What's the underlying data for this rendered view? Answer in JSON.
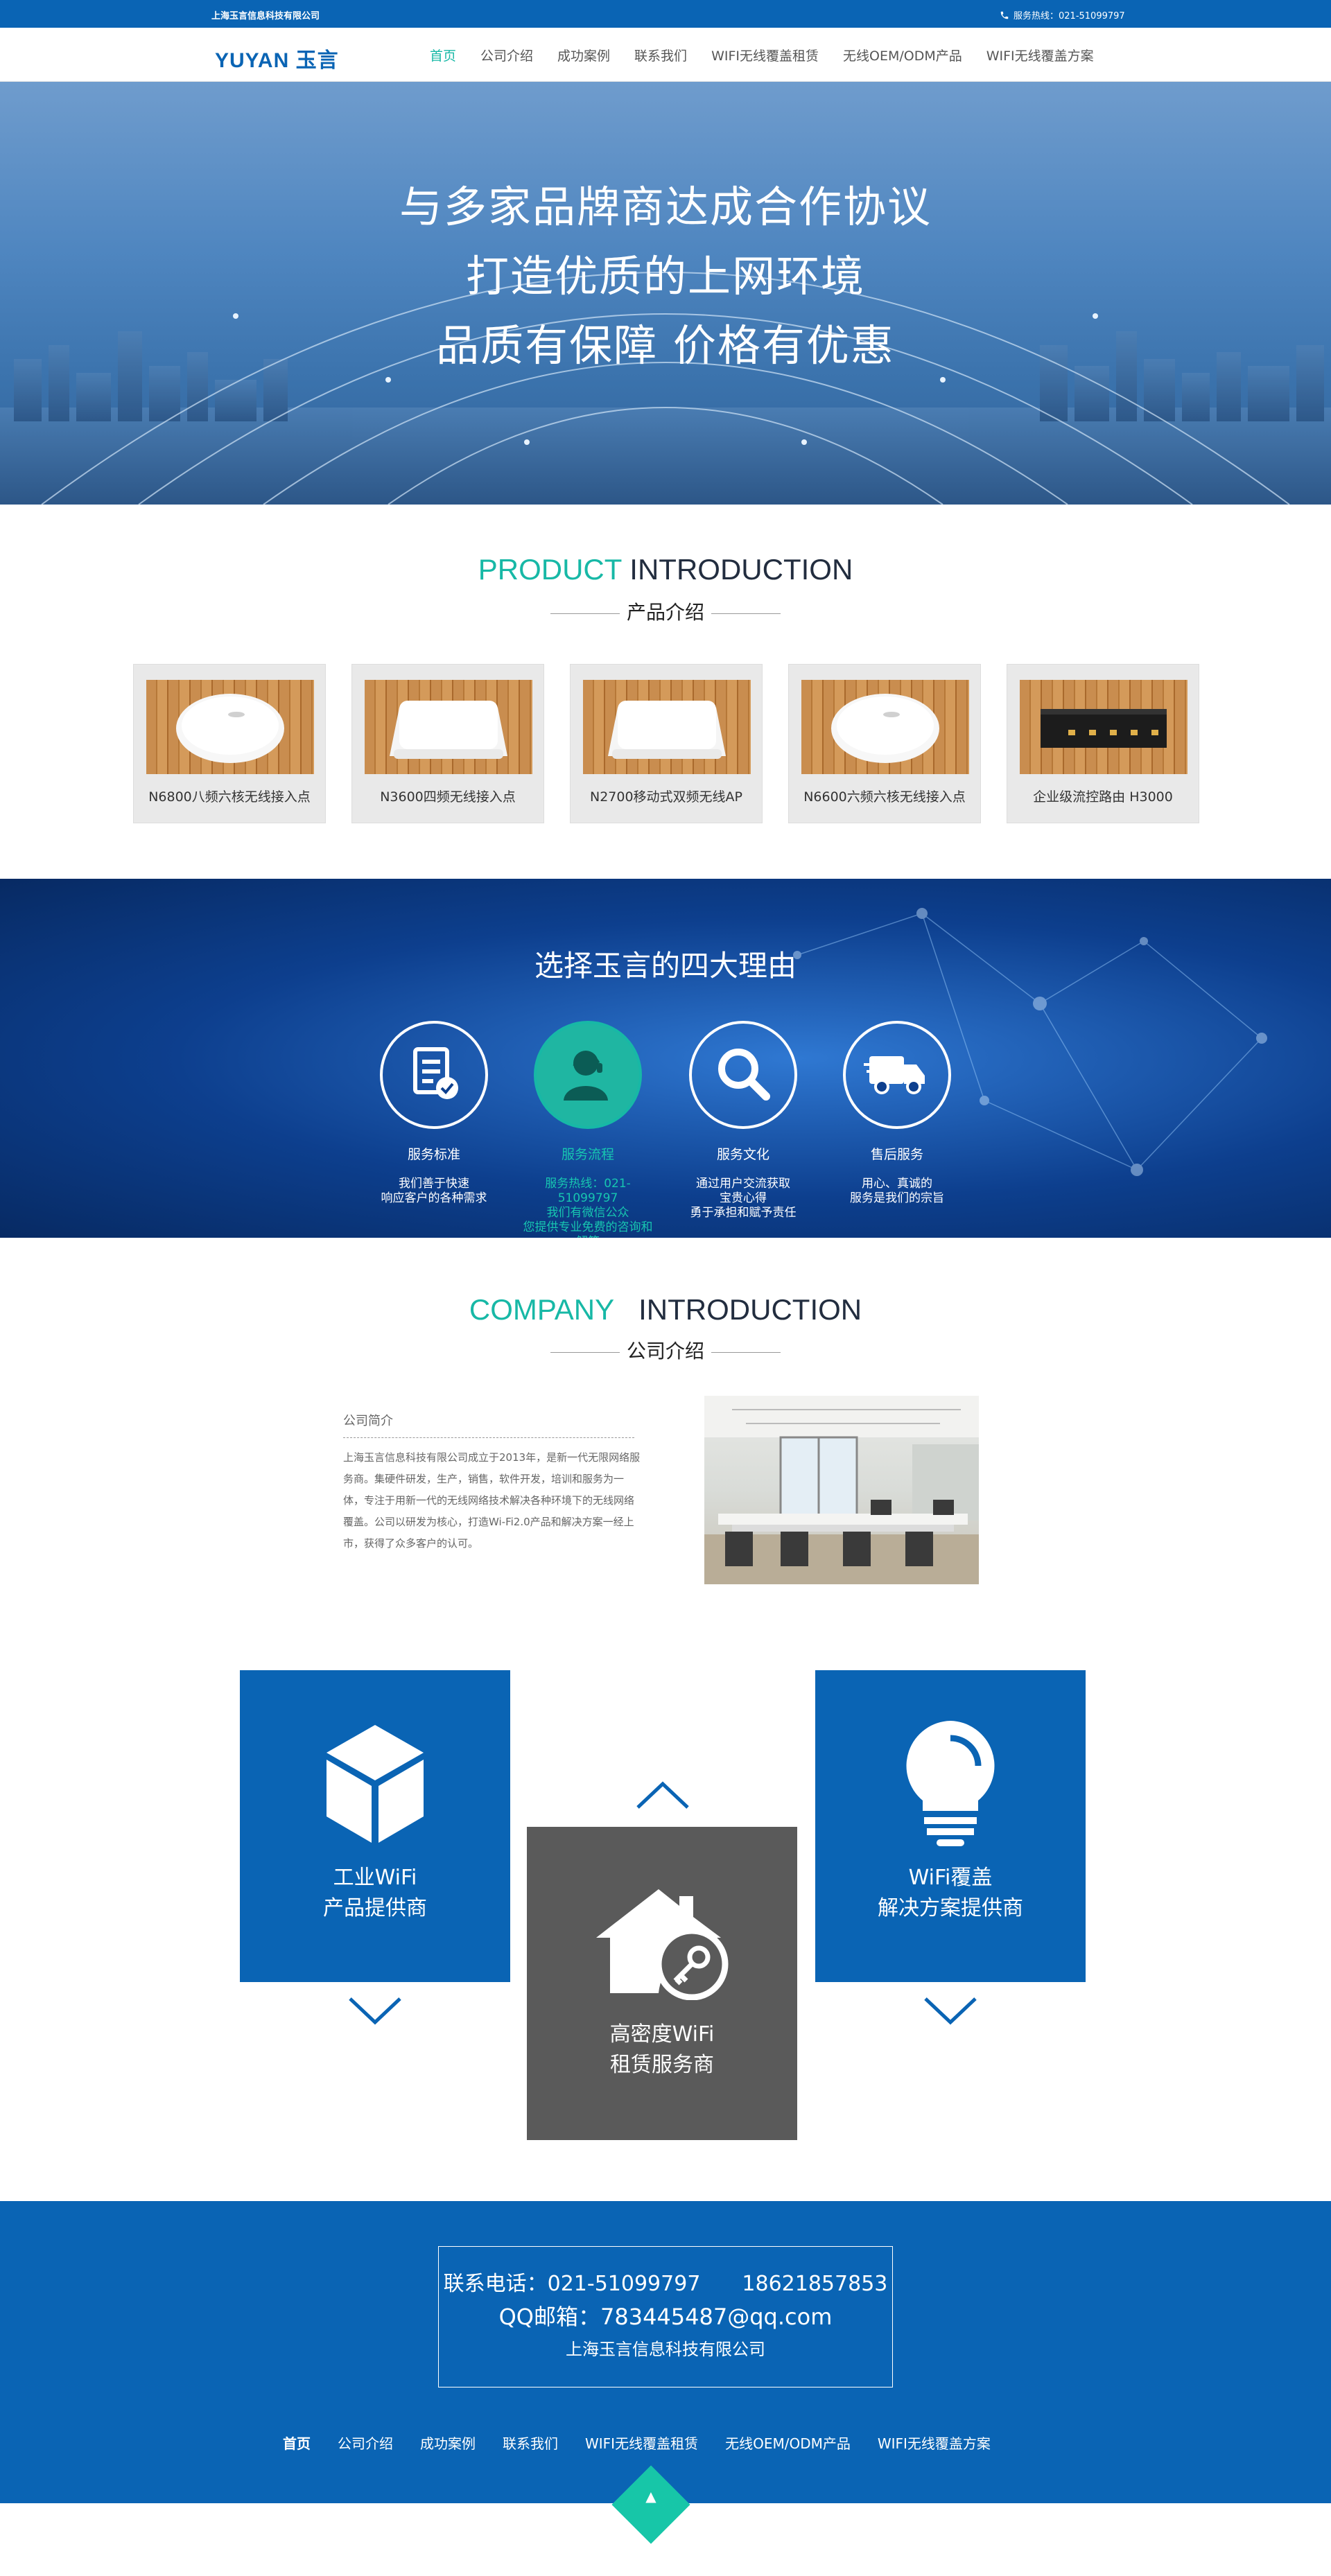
{
  "topbar": {
    "company": "上海玉言信息科技有限公司",
    "hotline": "服务热线：021-51099797"
  },
  "nav": {
    "logo": "YUYAN 玉言",
    "items": [
      "首页",
      "公司介绍",
      "成功案例",
      "联系我们",
      "WIFI无线覆盖租赁",
      "无线OEM/ODM产品",
      "WIFI无线覆盖方案"
    ],
    "active": 0
  },
  "hero": {
    "lines": [
      "与多家品牌商达成合作协议",
      "打造优质的上网环境",
      "品质有保障 价格有优惠"
    ]
  },
  "products": {
    "title_accent": "PRODUCT",
    "title_rest": "INTRODUCTION",
    "subtitle": "产品介绍",
    "items": [
      {
        "label": "N6800八频六核无线接入点",
        "shape": "round"
      },
      {
        "label": "N3600四频无线接入点",
        "shape": "square"
      },
      {
        "label": "N2700移动式双频无线AP",
        "shape": "square"
      },
      {
        "label": "N6600六频六核无线接入点",
        "shape": "round"
      },
      {
        "label": "企业级流控路由 H3000",
        "shape": "router"
      }
    ]
  },
  "reasons": {
    "title": "选择玉言的四大理由",
    "items": [
      {
        "name": "服务标准",
        "desc": [
          "我们善于快速",
          "响应客户的各种需求"
        ],
        "icon": "document-check-icon"
      },
      {
        "name": "服务流程",
        "desc": [
          "服务热线：021-51099797",
          "我们有微信公众",
          "您提供专业免费的咨询和解答"
        ],
        "icon": "customer-service-icon"
      },
      {
        "name": "服务文化",
        "desc": [
          "通过用户交流获取",
          "宝贵心得",
          "勇于承担和赋予责任"
        ],
        "icon": "search-icon"
      },
      {
        "name": "售后服务",
        "desc": [
          "用心、真诚的",
          "服务是我们的宗旨"
        ],
        "icon": "delivery-truck-icon"
      }
    ]
  },
  "company": {
    "title_accent": "COMPANY",
    "title_rest": "INTRODUCTION",
    "subtitle": "公司介绍",
    "heading": "公司简介",
    "text": "上海玉言信息科技有限公司成立于2013年，是新一代无限网络服务商。集硬件研发，生产，销售，软件开发，培训和服务为一体，专注于用新一代的无线网络技术解决各种环境下的无线网络覆盖。公司以研发为核心，打造Wi-Fi2.0产品和解决方案一经上市，获得了众多客户的认可。"
  },
  "services": [
    {
      "lines": [
        "工业WiFi",
        "产品提供商"
      ],
      "icon": "cube-icon"
    },
    {
      "lines": [
        "高密度WiFi",
        "租赁服务商"
      ],
      "icon": "house-key-icon"
    },
    {
      "lines": [
        "WiFi覆盖",
        "解决方案提供商"
      ],
      "icon": "lightbulb-icon"
    }
  ],
  "colors": {
    "brand": "#0a64b4",
    "accent": "#17b8a6",
    "dark_box": "#5a5a5a"
  },
  "footer": {
    "phone": "联系电话：021-51099797　　18621857853",
    "qq": "QQ邮箱：783445487@qq.com",
    "company": "上海玉言信息科技有限公司",
    "menu": [
      "首页",
      "公司介绍",
      "成功案例",
      "联系我们",
      "WIFI无线覆盖租赁",
      "无线OEM/ODM产品",
      "WIFI无线覆盖方案"
    ]
  }
}
